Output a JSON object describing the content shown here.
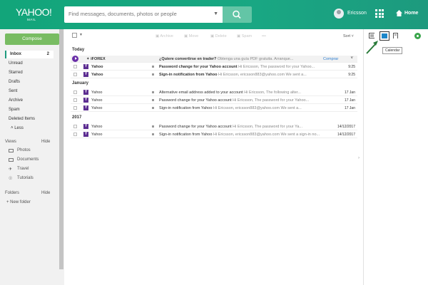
{
  "brand": {
    "logo": "YAHOO!",
    "sub": "MAIL"
  },
  "search": {
    "placeholder": "Find messages, documents, photos or people"
  },
  "header": {
    "user": "Ericsson",
    "home": "Home"
  },
  "compose": "Compose",
  "nav": [
    {
      "label": "Inbox",
      "count": "2"
    },
    {
      "label": "Unread"
    },
    {
      "label": "Starred"
    },
    {
      "label": "Drafts"
    },
    {
      "label": "Sent"
    },
    {
      "label": "Archive"
    },
    {
      "label": "Spam"
    },
    {
      "label": "Deleted Items"
    },
    {
      "label": "Less"
    }
  ],
  "views": {
    "title": "Views",
    "hide": "Hide",
    "items": [
      "Photos",
      "Documents",
      "Travel",
      "Tutorials"
    ]
  },
  "folders": {
    "title": "Folders",
    "hide": "Hide",
    "new": "New folder"
  },
  "toolbar": {
    "archive": "Archive",
    "move": "Move",
    "delete": "Delete",
    "spam": "Spam",
    "more": "•••",
    "sort": "Sort"
  },
  "groups": [
    "Today",
    "January",
    "2017"
  ],
  "ad": {
    "sender": "iFOREX",
    "subject": "¿Quiere convertirse en trader?",
    "snippet": "Obtenga una guía PDF gratuita. Arranque...",
    "cta": "Comprar"
  },
  "messages": [
    {
      "sender": "Yahoo",
      "subject": "Password change for your Yahoo account",
      "snippet": "Hi Ericsson, The password for your Yahoo...",
      "date": "9:25",
      "bold": true
    },
    {
      "sender": "Yahoo",
      "subject": "Sign-in notification from Yahoo",
      "snippet": "Hi Ericsson, ericsson883@yahoo.com We sent a...",
      "date": "9:25",
      "bold": true
    },
    {
      "sender": "Yahoo",
      "subject": "Alternative email address added to your account",
      "snippet": "Hi Ericsson, The following alter...",
      "date": "17 Jan",
      "bold": false
    },
    {
      "sender": "Yahoo",
      "subject": "Password change for your Yahoo account",
      "snippet": "Hi Ericsson, The password for your Yahoo...",
      "date": "17 Jan",
      "bold": false
    },
    {
      "sender": "Yahoo",
      "subject": "Sign-in notification from Yahoo",
      "snippet": "Hi Ericsson, ericsson883@yahoo.com We sent a...",
      "date": "17 Jan",
      "bold": false
    },
    {
      "sender": "Yahoo",
      "subject": "Password change for your Yahoo account",
      "snippet": "Hi Ericsson, The password for your Ya...",
      "date": "14/12/2017",
      "bold": false
    },
    {
      "sender": "Yahoo",
      "subject": "Sign-in notification from Yahoo",
      "snippet": "Hi Ericsson, ericsson883@yahoo.com We sent a sign-in no...",
      "date": "14/12/2017",
      "bold": false
    }
  ],
  "rightpanel": {
    "tooltip": "Calendar"
  }
}
